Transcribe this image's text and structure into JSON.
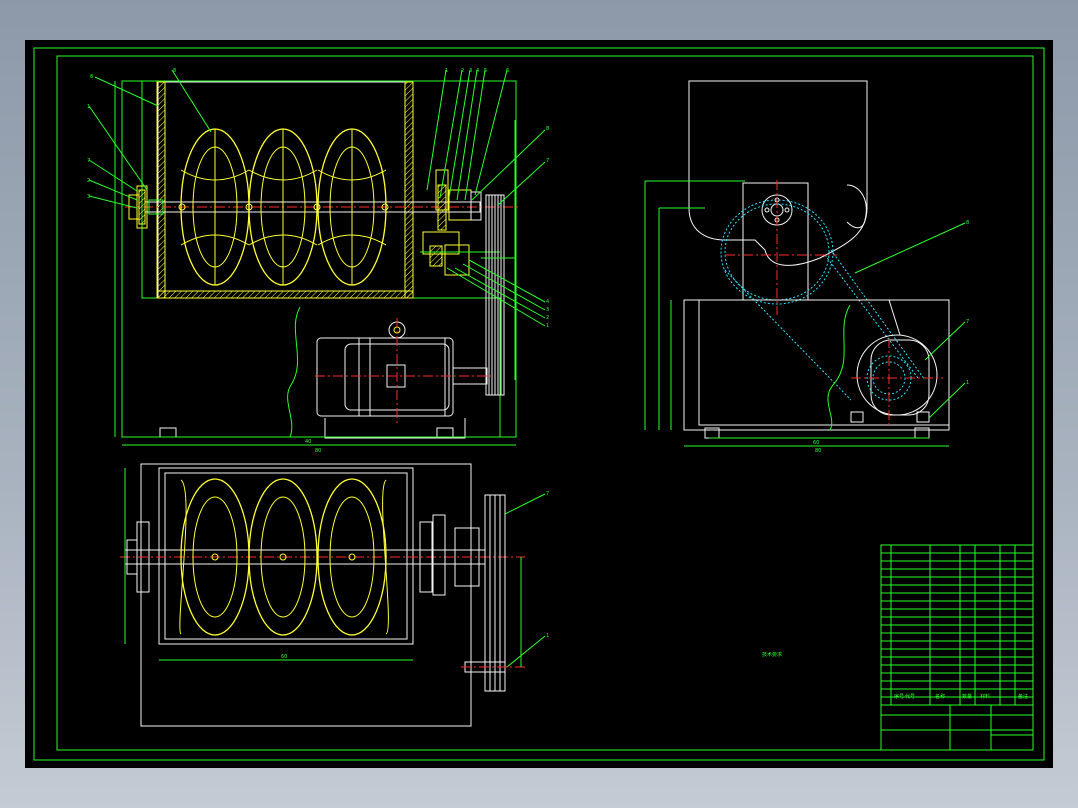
{
  "drawing": {
    "background": "#000000",
    "line_colors": {
      "outline": "#29ff29",
      "part": "#ffff33",
      "centerline": "#ff2a2a",
      "belt": "#29e6ff",
      "edge": "#f4f4f4"
    }
  },
  "balloons": {
    "front_left": [
      "8",
      "8",
      "1",
      "7",
      "2",
      "3"
    ],
    "front_top": [
      "1",
      "2",
      "3",
      "4",
      "5",
      "6"
    ],
    "front_right": [
      "8",
      "7",
      "4",
      "3",
      "2",
      "1"
    ],
    "side_view": [
      "8",
      "7",
      "1"
    ],
    "top_view": [
      "7",
      "1"
    ]
  },
  "technical_notes": {
    "title": "技术要求",
    "lines": [
      "",
      "",
      "",
      "",
      ""
    ]
  },
  "title_block": {
    "column_labels": [
      "序号",
      "代号",
      "名称",
      "数量",
      "材料",
      "备注"
    ],
    "cells": [
      "",
      "",
      "",
      "",
      ""
    ]
  }
}
